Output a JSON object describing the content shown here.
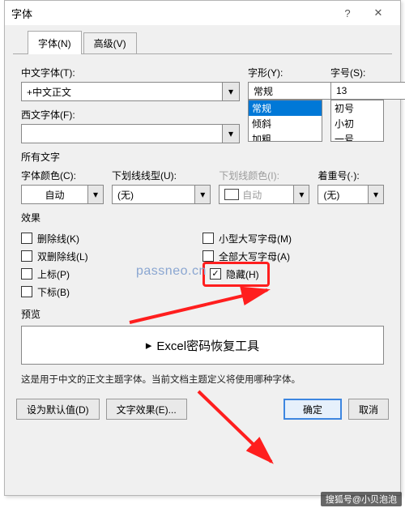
{
  "titlebar": {
    "title": "字体"
  },
  "tabs": {
    "font": "字体(N)",
    "advanced": "高级(V)"
  },
  "cn_font": {
    "label": "中文字体(T):",
    "value": "+中文正文"
  },
  "west_font": {
    "label": "西文字体(F):",
    "value": ""
  },
  "style": {
    "label": "字形(Y):",
    "value": "常规",
    "options": [
      "常规",
      "倾斜",
      "加粗"
    ]
  },
  "size": {
    "label": "字号(S):",
    "value": "13",
    "options": [
      "初号",
      "小初",
      "一号"
    ]
  },
  "all_text_label": "所有文字",
  "font_color": {
    "label": "字体颜色(C):",
    "value": "自动"
  },
  "underline_style": {
    "label": "下划线线型(U):",
    "value": "(无)"
  },
  "underline_color": {
    "label": "下划线颜色(I):",
    "value": "自动"
  },
  "emphasis": {
    "label": "着重号(·):",
    "value": "(无)"
  },
  "effects_label": "效果",
  "checks": {
    "strike": "删除线(K)",
    "dbl_strike": "双删除线(L)",
    "superscript": "上标(P)",
    "subscript": "下标(B)",
    "smallcaps": "小型大写字母(M)",
    "allcaps": "全部大写字母(A)",
    "hidden": "隐藏(H)"
  },
  "preview": {
    "label": "预览",
    "text": "Excel密码恢复工具"
  },
  "hint": "这是用于中文的正文主题字体。当前文档主题定义将使用哪种字体。",
  "footer": {
    "set_default": "设为默认值(D)",
    "text_effects": "文字效果(E)...",
    "ok": "确定",
    "cancel": "取消"
  },
  "watermark": "passneo.cn",
  "sohu": "搜狐号@小贝泡泡"
}
